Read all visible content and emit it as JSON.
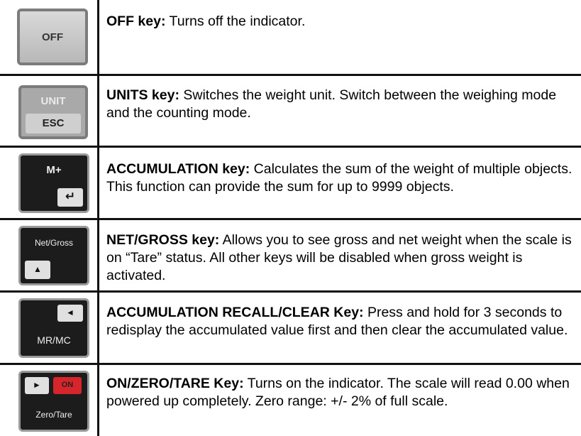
{
  "rows": [
    {
      "key_label": "OFF",
      "title": "OFF key:",
      "desc": " Turns off the indicator."
    },
    {
      "key_top": "UNIT",
      "key_bottom": "ESC",
      "title": "UNITS key:",
      "desc": " Switches the weight unit. Switch between the weighing mode and the counting mode."
    },
    {
      "key_top": "M+",
      "key_bottom": "↵",
      "title": "ACCUMULATION key:",
      "desc": " Calculates the sum of the weight of multiple objects. This function can provide the sum for up to 9999 objects."
    },
    {
      "key_top": "Net/Gross",
      "key_bottom": "▲",
      "title": "NET/GROSS key:",
      "desc": " Allows you to see gross and net weight when the scale is on “Tare” status. All other keys will be disabled when gross weight is activated."
    },
    {
      "key_top": "◄",
      "key_bottom": "MR/MC",
      "title": "ACCUMULATION RECALL/CLEAR Key:",
      "desc": " Press and hold for 3 seconds to redisplay the accumulated value first and then clear the accumulated value."
    },
    {
      "key_top_left": "►",
      "key_top_right": "ON",
      "key_bottom": "Zero/Tare",
      "title": "ON/ZERO/TARE Key:",
      "desc": " Turns on the indicator. The scale will read 0.00 when powered up completely. Zero range: +/- 2% of full scale."
    }
  ],
  "colors": {
    "on_red": "#d7262b",
    "key_dark": "#1c1c1c",
    "key_light": "#c9c9c9"
  }
}
